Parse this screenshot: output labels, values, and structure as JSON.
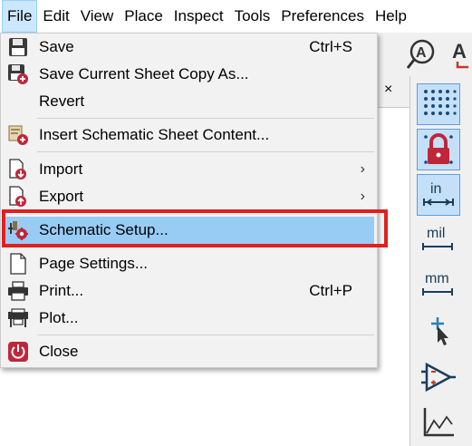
{
  "menubar": {
    "items": [
      "File",
      "Edit",
      "View",
      "Place",
      "Inspect",
      "Tools",
      "Preferences",
      "Help"
    ]
  },
  "file_menu": {
    "save": {
      "label": "Save",
      "shortcut": "Ctrl+S"
    },
    "save_copy": {
      "label": "Save Current Sheet Copy As..."
    },
    "revert": {
      "label": "Revert"
    },
    "insert_sheet": {
      "label": "Insert Schematic Sheet Content..."
    },
    "import": {
      "label": "Import"
    },
    "export": {
      "label": "Export"
    },
    "schematic_setup": {
      "label": "Schematic Setup..."
    },
    "page_settings": {
      "label": "Page Settings..."
    },
    "print": {
      "label": "Print...",
      "shortcut": "Ctrl+P"
    },
    "plot": {
      "label": "Plot..."
    },
    "close": {
      "label": "Close"
    }
  },
  "panel": {
    "close_glyph": "×"
  },
  "right_toolbar": {
    "units_in": "in",
    "units_mil": "mil",
    "units_mm": "mm"
  },
  "colors": {
    "highlight": "#99ccf5",
    "annotation_box": "#e02020",
    "toolbar_active": "#c4e0f9"
  },
  "icons": [
    "save-icon",
    "save-copy-icon",
    "insert-sheet-icon",
    "import-icon",
    "export-icon",
    "schematic-setup-icon",
    "page-settings-icon",
    "print-icon",
    "plot-icon",
    "close-icon",
    "submenu-arrow-icon",
    "grid-icon",
    "lock-icon",
    "inch-units-icon",
    "mil-units-icon",
    "mm-units-icon",
    "cursor-icon",
    "opamp-icon",
    "graph-icon",
    "annotate-icon"
  ]
}
